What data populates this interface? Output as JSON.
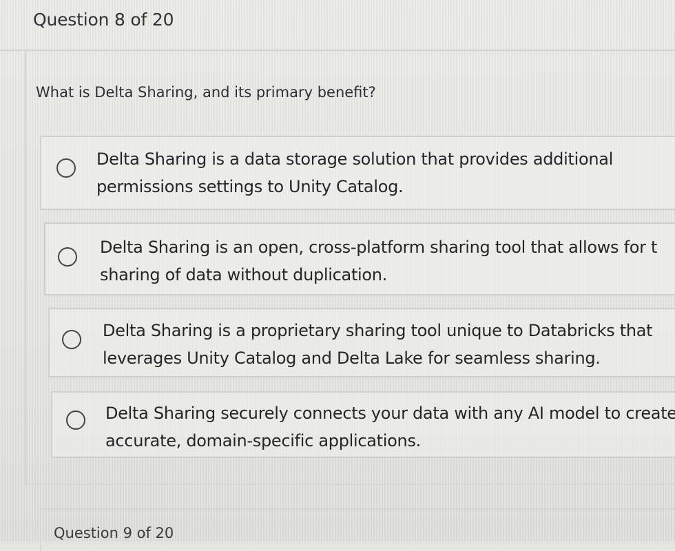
{
  "header": {
    "question_counter": "Question 8 of 20"
  },
  "question": {
    "text": "What is Delta Sharing, and its primary benefit?"
  },
  "options": [
    {
      "text": "Delta Sharing is a data storage solution that provides additional\npermissions settings to Unity Catalog."
    },
    {
      "text": "Delta Sharing is an open, cross-platform sharing tool that allows for t\nsharing of data without duplication."
    },
    {
      "text": "Delta Sharing is a proprietary sharing tool unique to Databricks that\nleverages Unity Catalog and Delta Lake for seamless sharing."
    },
    {
      "text": "Delta Sharing securely connects your data with any AI model to create\naccurate, domain-specific applications."
    }
  ],
  "next_question": {
    "counter": "Question 9 of 20"
  }
}
